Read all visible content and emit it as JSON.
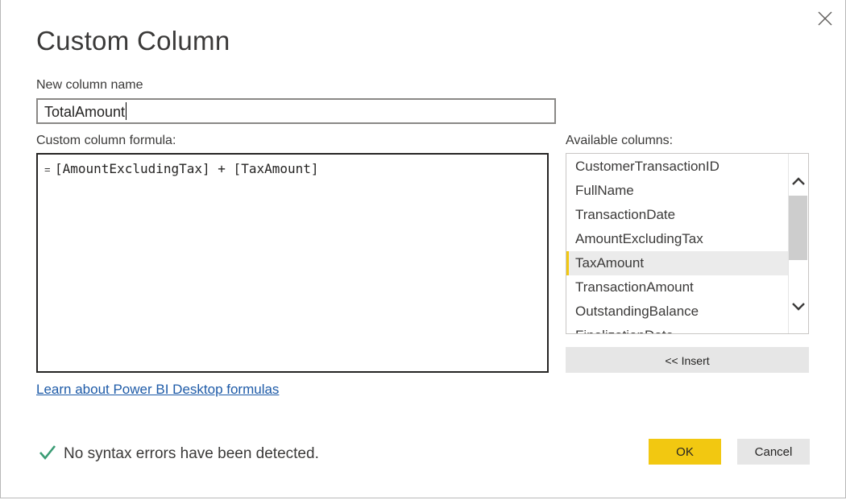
{
  "dialog": {
    "title": "Custom Column",
    "close_icon": "close-icon"
  },
  "name_field": {
    "label": "New column name",
    "value": "TotalAmount"
  },
  "formula": {
    "label": "Custom column formula:",
    "prefix": "=",
    "value": "[AmountExcludingTax] + [TaxAmount]"
  },
  "learn_link": {
    "text": "Learn about Power BI Desktop formulas"
  },
  "columns": {
    "label": "Available columns:",
    "items": [
      {
        "label": "CustomerTransactionID"
      },
      {
        "label": "FullName"
      },
      {
        "label": "TransactionDate"
      },
      {
        "label": "AmountExcludingTax"
      },
      {
        "label": "TaxAmount"
      },
      {
        "label": "TransactionAmount"
      },
      {
        "label": "OutstandingBalance"
      },
      {
        "label": "FinalizationDate"
      }
    ],
    "selected_label": "TaxAmount",
    "insert_label": "<< Insert",
    "scroll_up_icon": "chevron-up-icon",
    "scroll_down_icon": "chevron-down-icon"
  },
  "status": {
    "icon": "check-icon",
    "text": "No syntax errors have been detected."
  },
  "buttons": {
    "ok_label": "OK",
    "cancel_label": "Cancel"
  },
  "colors": {
    "accent": "#F2C811",
    "link": "#1E5BA8",
    "check": "#3A9C74",
    "button_gray": "#E6E6E6"
  }
}
